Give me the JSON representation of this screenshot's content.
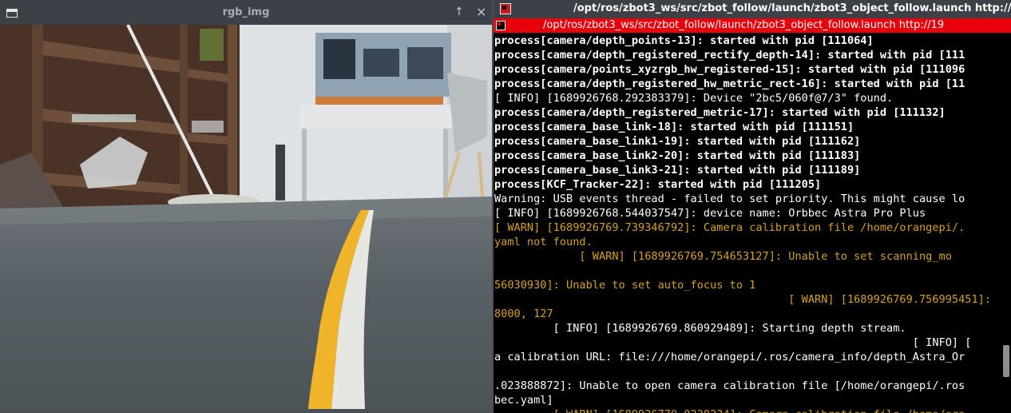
{
  "left_window": {
    "title": "rgb_img",
    "icon": "window-icon",
    "controls": {
      "up": "↑",
      "close": "×"
    }
  },
  "right_window": {
    "title": "/opt/ros/zbot3_ws/src/zbot_follow/launch/zbot3_object_follow.launch http://192.16",
    "tab_title": "/opt/ros/zbot3_ws/src/zbot_follow/launch/zbot3_object_follow.launch http://19",
    "icon": "terminal-icon",
    "colors": {
      "tab_bg": "#e8000b",
      "warn": "#d6a215",
      "text": "#ffffff"
    }
  },
  "terminal": {
    "lines": [
      {
        "text": "process[camera/depth_points-13]: started with pid [111064]",
        "style": "bold"
      },
      {
        "text": "process[camera/depth_registered_rectify_depth-14]: started with pid [111",
        "style": "bold"
      },
      {
        "text": "process[camera/points_xyzrgb_hw_registered-15]: started with pid [111096",
        "style": "bold"
      },
      {
        "text": "process[camera/depth_registered_hw_metric_rect-16]: started with pid [11",
        "style": "bold"
      },
      {
        "text": "[ INFO] [1689926768.292383379]: Device \"2bc5/060f@7/3\" found.",
        "style": "normal"
      },
      {
        "text": "process[camera/depth_registered_metric-17]: started with pid [111132]",
        "style": "bold"
      },
      {
        "text": "process[camera_base_link-18]: started with pid [111151]",
        "style": "bold"
      },
      {
        "text": "process[camera_base_link1-19]: started with pid [111162]",
        "style": "bold"
      },
      {
        "text": "process[camera_base_link2-20]: started with pid [111183]",
        "style": "bold"
      },
      {
        "text": "process[camera_base_link3-21]: started with pid [111189]",
        "style": "bold"
      },
      {
        "text": "process[KCF_Tracker-22]: started with pid [111205]",
        "style": "bold"
      },
      {
        "text": "Warning: USB events thread - failed to set priority. This might cause lo",
        "style": "normal"
      },
      {
        "text": "[ INFO] [1689926768.544037547]: device name: Orbbec Astra Pro Plus",
        "style": "normal"
      },
      {
        "text": "[ WARN] [1689926769.739346792]: Camera calibration file /home/orangepi/.",
        "style": "warn"
      },
      {
        "text": "yaml not found.",
        "style": "warn"
      },
      {
        "text": "             [ WARN] [1689926769.754653127]: Unable to set scanning_mo",
        "style": "warn"
      },
      {
        "text": "",
        "style": "warn"
      },
      {
        "text": "56030930]: Unable to set auto_focus to 1",
        "style": "warn"
      },
      {
        "text": "                                             [ WARN] [1689926769.756995451]:",
        "style": "warn"
      },
      {
        "text": "8000, 127",
        "style": "warn"
      },
      {
        "text": "         [ INFO] [1689926769.860929489]: Starting depth stream.",
        "style": "normal"
      },
      {
        "text": "                                                                [ INFO] [",
        "style": "normal"
      },
      {
        "text": "a calibration URL: file:///home/orangepi/.ros/camera_info/depth_Astra_Or",
        "style": "normal"
      },
      {
        "text": "",
        "style": "normal"
      },
      {
        "text": ".023888872]: Unable to open camera calibration file [/home/orangepi/.ros",
        "style": "normal"
      },
      {
        "text": "bec.yaml]",
        "style": "normal"
      },
      {
        "text": "         [ WARN] [1689926770.0238234]: Camera calibration file /home/ora",
        "style": "warn"
      }
    ]
  }
}
